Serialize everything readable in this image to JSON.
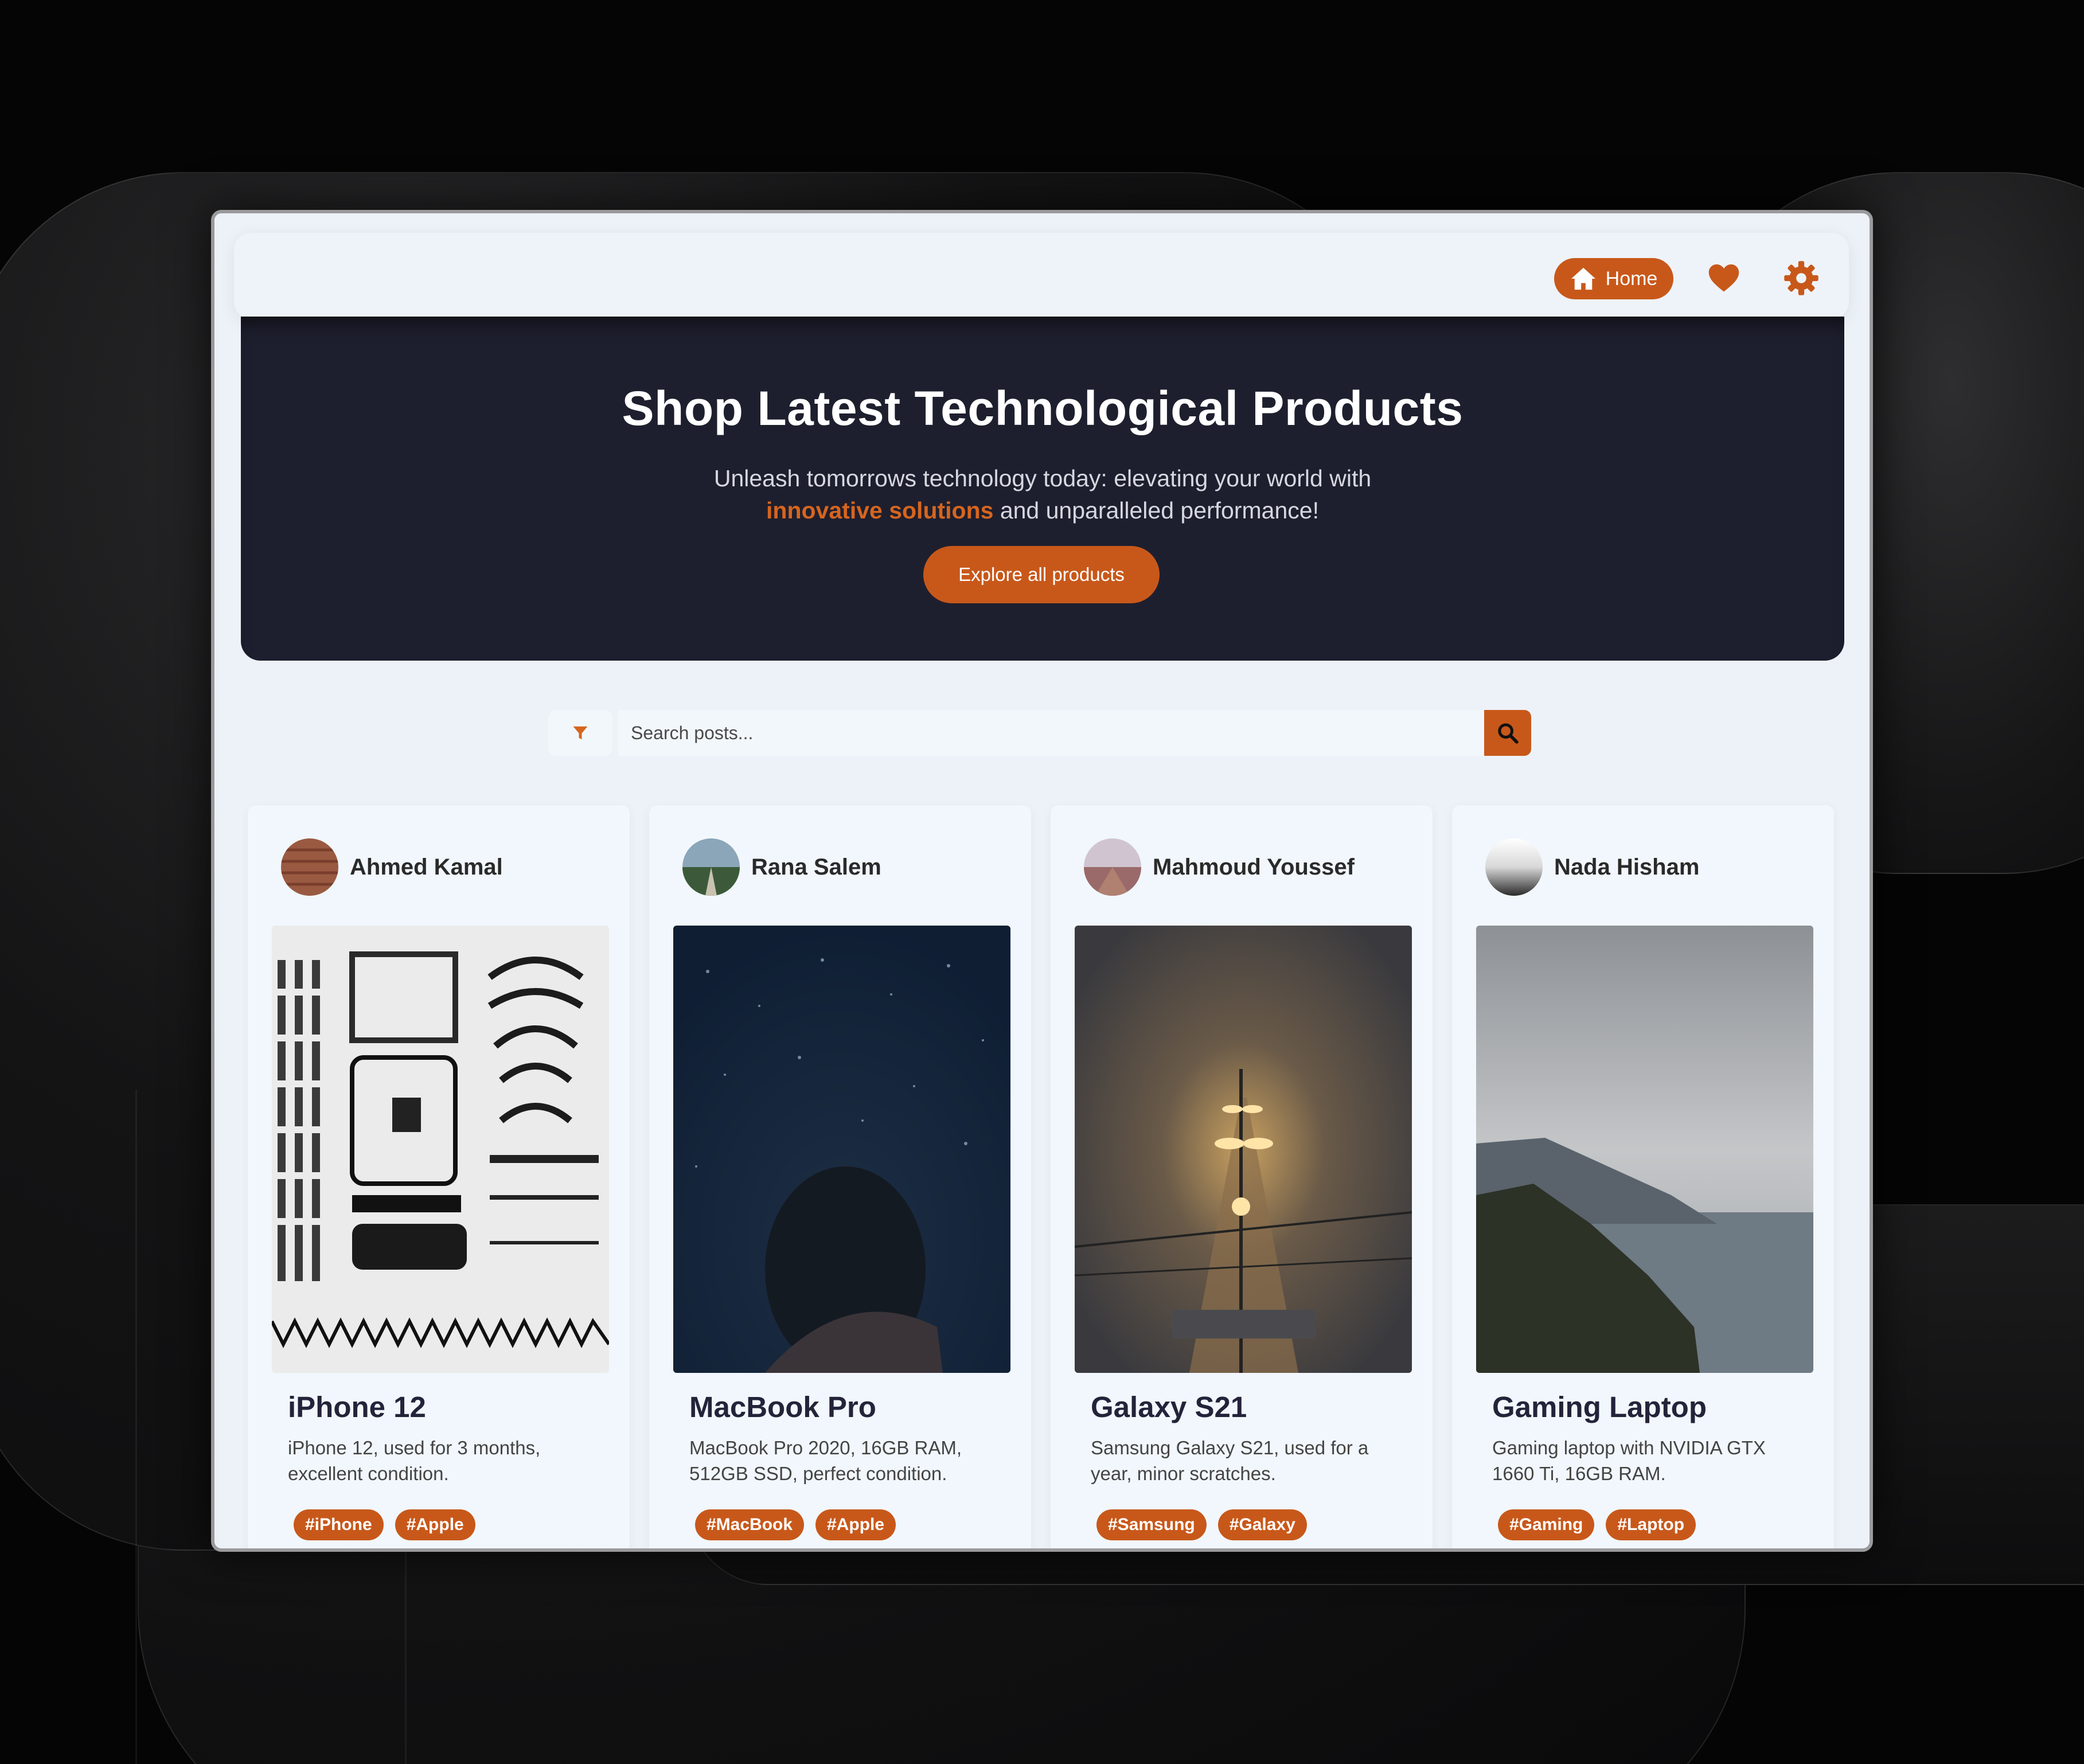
{
  "nav": {
    "home_label": "Home",
    "home_icon": "home-icon",
    "favorites_icon": "heart-icon",
    "settings_icon": "gear-icon"
  },
  "hero": {
    "title": "Shop Latest Technological Products",
    "subtitle_line1": "Unleash tomorrows technology today: elevating your world with",
    "subtitle_highlight": "innovative solutions",
    "subtitle_line2_rest": " and unparalleled performance!",
    "button_label": "Explore all products"
  },
  "search": {
    "placeholder": "Search posts...",
    "filter_icon": "filter-icon",
    "search_icon": "search-icon"
  },
  "posts": [
    {
      "author": "Ahmed Kamal",
      "title": "iPhone 12",
      "description": "iPhone 12, used for 3 months, excellent condition.",
      "tags": [
        "#iPhone",
        "#Apple"
      ]
    },
    {
      "author": "Rana Salem",
      "title": "MacBook Pro",
      "description": "MacBook Pro 2020, 16GB RAM, 512GB SSD, perfect condition.",
      "tags": [
        "#MacBook",
        "#Apple"
      ]
    },
    {
      "author": "Mahmoud Youssef",
      "title": "Galaxy S21",
      "description": "Samsung Galaxy S21, used for a year, minor scratches.",
      "tags": [
        "#Samsung",
        "#Galaxy"
      ]
    },
    {
      "author": "Nada Hisham",
      "title": "Gaming Laptop",
      "description": "Gaming laptop with NVIDIA GTX 1660 Ti, 16GB RAM.",
      "tags": [
        "#Gaming",
        "#Laptop"
      ]
    }
  ],
  "colors": {
    "accent": "#c8581a",
    "hero_bg": "#1e1f2e",
    "page_bg": "#edf2f8",
    "card_bg": "#f1f7fc"
  }
}
